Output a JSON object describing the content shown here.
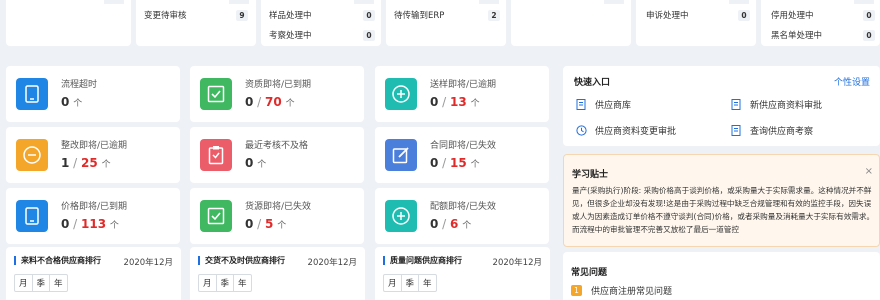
{
  "top_status": [
    {
      "label": "变更待审核",
      "count": "9"
    },
    {
      "label": "样品处理中",
      "count": "0"
    },
    {
      "label": "考察处理中",
      "count": "0"
    },
    {
      "label": "待传输到ERP",
      "count": "2"
    },
    {
      "label": "申诉处理中",
      "count": "0"
    },
    {
      "label": "停用处理中",
      "count": "0"
    },
    {
      "label": "黑名单处理中",
      "count": "0"
    }
  ],
  "metrics": [
    {
      "title": "流程超时",
      "a": "0",
      "sep": "",
      "b": "",
      "unit": "个",
      "color": "#1f86e6",
      "icon": "phone-icon"
    },
    {
      "title": "资质即将/已到期",
      "a": "0",
      "sep": " / ",
      "b": "70",
      "unit": "个",
      "color": "#3fb861",
      "icon": "check-square-icon"
    },
    {
      "title": "送样即将/已逾期",
      "a": "0",
      "sep": " / ",
      "b": "13",
      "unit": "个",
      "color": "#1fbcb2",
      "icon": "plus-circle-icon"
    },
    {
      "title": "整改即将/已逾期",
      "a": "1",
      "sep": " / ",
      "b": "25",
      "unit": "个",
      "color": "#f4a62a",
      "icon": "minus-circle-icon"
    },
    {
      "title": "最近考核不及格",
      "a": "0",
      "sep": "",
      "b": "",
      "unit": "个",
      "color": "#ec5d6a",
      "icon": "clipboard-icon"
    },
    {
      "title": "合同即将/已失效",
      "a": "0",
      "sep": " / ",
      "b": "15",
      "unit": "个",
      "color": "#4b7fdc",
      "icon": "edit-icon"
    },
    {
      "title": "价格即将/已到期",
      "a": "0",
      "sep": " / ",
      "b": "113",
      "unit": "个",
      "color": "#1f86e6",
      "icon": "phone-icon"
    },
    {
      "title": "货源即将/已失效",
      "a": "0",
      "sep": " / ",
      "b": "5",
      "unit": "个",
      "color": "#3fb861",
      "icon": "check-square-icon"
    },
    {
      "title": "配额即将/已失效",
      "a": "0",
      "sep": " / ",
      "b": "6",
      "unit": "个",
      "color": "#1fbcb2",
      "icon": "plus-circle-icon"
    }
  ],
  "rankings": [
    {
      "title": "来料不合格供应商排行",
      "date": "2020年12月",
      "btns": [
        "月",
        "季",
        "年"
      ]
    },
    {
      "title": "交货不及时供应商排行",
      "date": "2020年12月",
      "btns": [
        "月",
        "季",
        "年"
      ]
    },
    {
      "title": "质量问题供应商排行",
      "date": "2020年12月",
      "btns": [
        "月",
        "季",
        "年"
      ]
    }
  ],
  "quick": {
    "title": "快速入口",
    "settings": "个性设置",
    "links": [
      {
        "label": "供应商库",
        "icon": "document-icon"
      },
      {
        "label": "新供应商资料审批",
        "icon": "document-icon"
      },
      {
        "label": "供应商资料变更审批",
        "icon": "clock-icon"
      },
      {
        "label": "查询供应商考察",
        "icon": "document-icon"
      }
    ]
  },
  "tips": {
    "title": "学习贴士",
    "close": "×",
    "text": "量产(采购执行)阶段: 采购价格高于谈判价格，或采购量大于实际需求量。这种情况并不鲜见，但很多企业却没有发现!这是由于采购过程中缺乏合规管理和有效的监控手段，因失误或人为因素造成订单价格不遵守谈判(合同)价格，或者采购量及消耗量大于实际有效需求。而流程中的审批管理不完善又放松了最后一道管控"
  },
  "faq": {
    "title": "常见问题",
    "items": [
      {
        "num": "1",
        "label": "供应商注册常见问题"
      }
    ]
  },
  "colors": {
    "accent": "#1f6fe0",
    "danger": "#e02b2b",
    "card_bg": "#ffffff",
    "page_bg": "#eef1f6"
  }
}
